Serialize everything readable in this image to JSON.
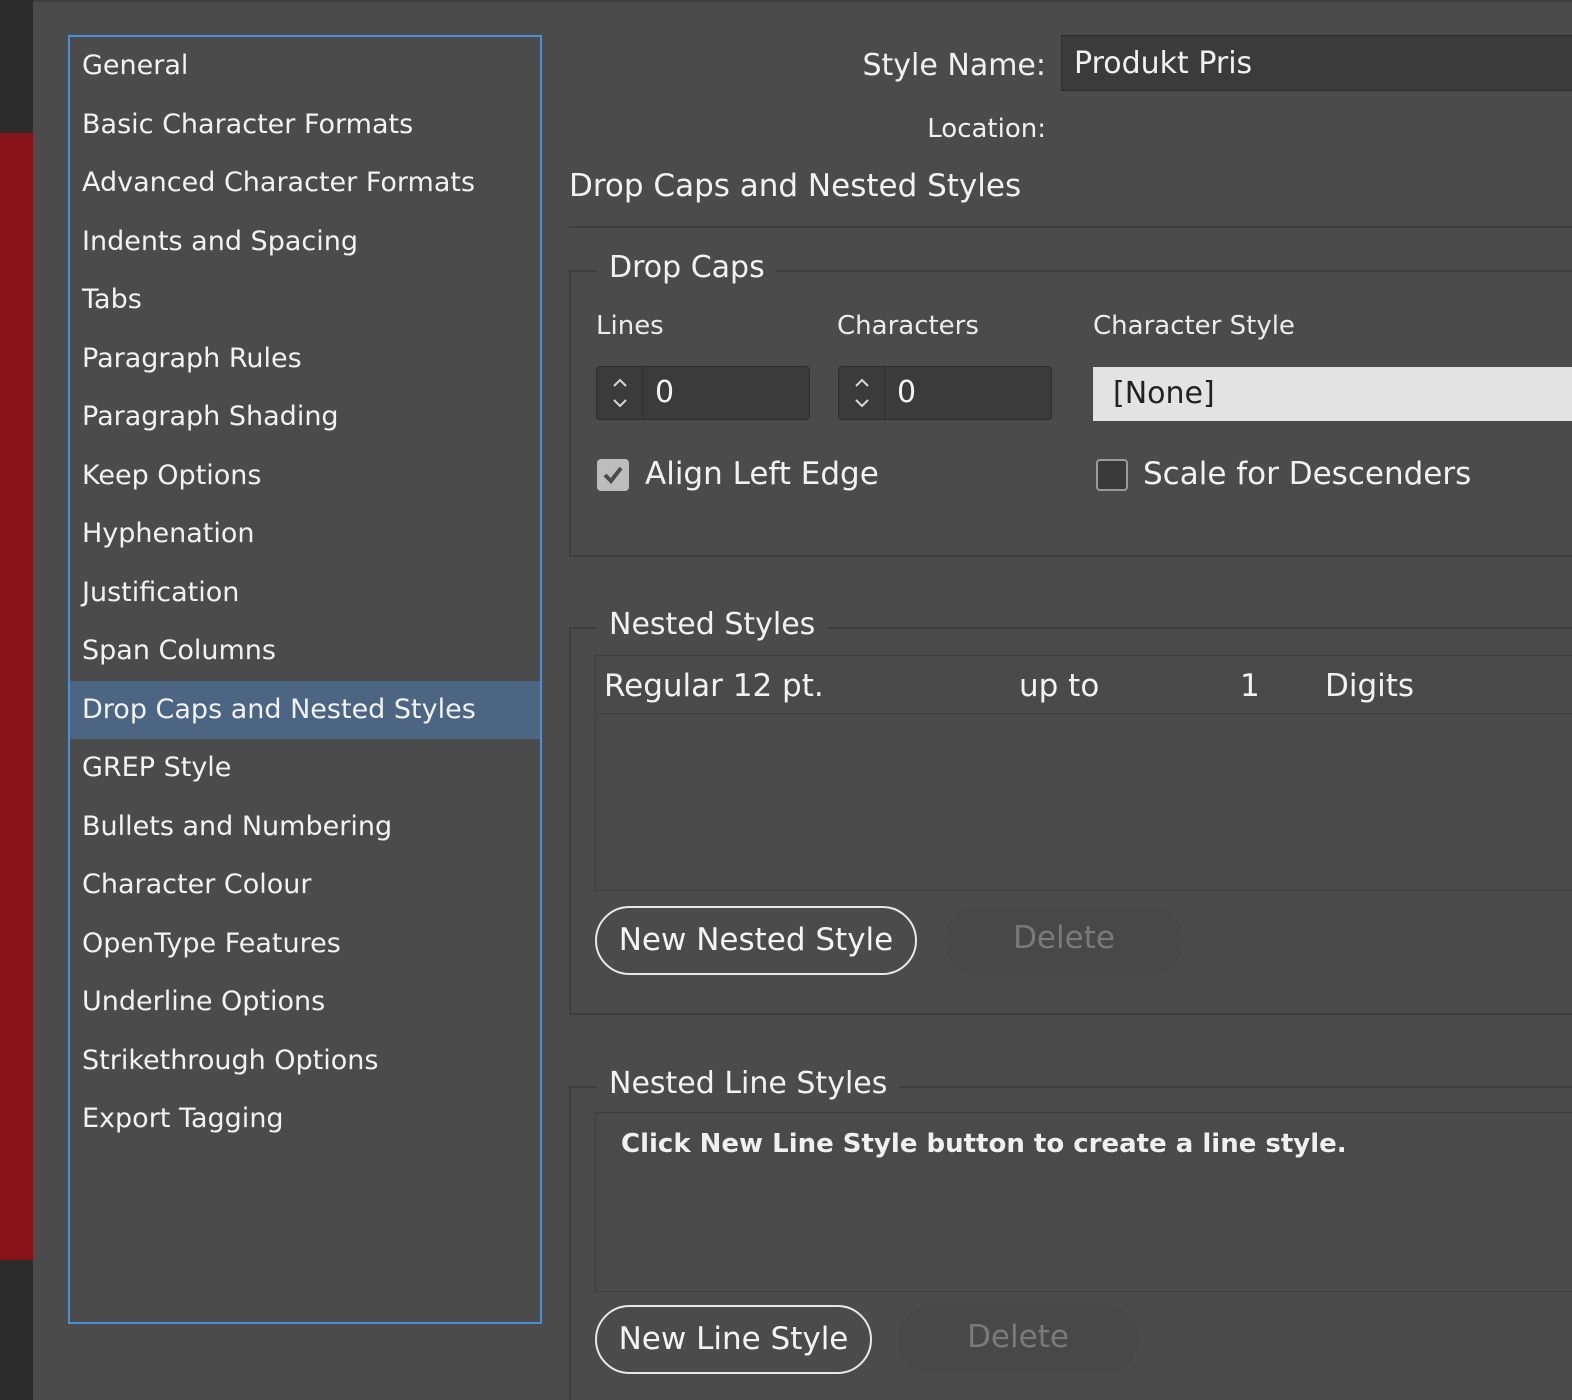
{
  "sidebar": {
    "items": [
      {
        "label": "General"
      },
      {
        "label": "Basic Character Formats"
      },
      {
        "label": "Advanced Character Formats"
      },
      {
        "label": "Indents and Spacing"
      },
      {
        "label": "Tabs"
      },
      {
        "label": "Paragraph Rules"
      },
      {
        "label": "Paragraph Shading"
      },
      {
        "label": "Keep Options"
      },
      {
        "label": "Hyphenation"
      },
      {
        "label": "Justification"
      },
      {
        "label": "Span Columns"
      },
      {
        "label": "Drop Caps and Nested Styles",
        "selected": true
      },
      {
        "label": "GREP Style"
      },
      {
        "label": "Bullets and Numbering"
      },
      {
        "label": "Character Colour"
      },
      {
        "label": "OpenType Features"
      },
      {
        "label": "Underline Options"
      },
      {
        "label": "Strikethrough Options"
      },
      {
        "label": "Export Tagging"
      }
    ]
  },
  "header": {
    "style_name_label": "Style Name:",
    "style_name_value": "Produkt Pris",
    "location_label": "Location:",
    "section_title": "Drop Caps and Nested Styles"
  },
  "drop_caps": {
    "legend": "Drop Caps",
    "lines_label": "Lines",
    "lines_value": "0",
    "characters_label": "Characters",
    "characters_value": "0",
    "character_style_label": "Character Style",
    "character_style_value": "[None]",
    "align_left_edge_label": "Align Left Edge",
    "align_left_edge_checked": true,
    "scale_for_descenders_label": "Scale for Descenders",
    "scale_for_descenders_checked": false
  },
  "nested_styles": {
    "legend": "Nested Styles",
    "rows": [
      {
        "style": "Regular 12 pt.",
        "mode": "up to",
        "count": "1",
        "unit": "Digits"
      }
    ],
    "new_button": "New Nested Style",
    "delete_button": "Delete"
  },
  "nested_line_styles": {
    "legend": "Nested Line Styles",
    "hint": "Click New Line Style button to create a line style.",
    "new_button": "New Line Style",
    "delete_button": "Delete"
  },
  "colors": {
    "selection": "#4c6582",
    "focus_border": "#4a8fd8",
    "panel": "#4b4b4b",
    "background_accent": "#861418"
  }
}
